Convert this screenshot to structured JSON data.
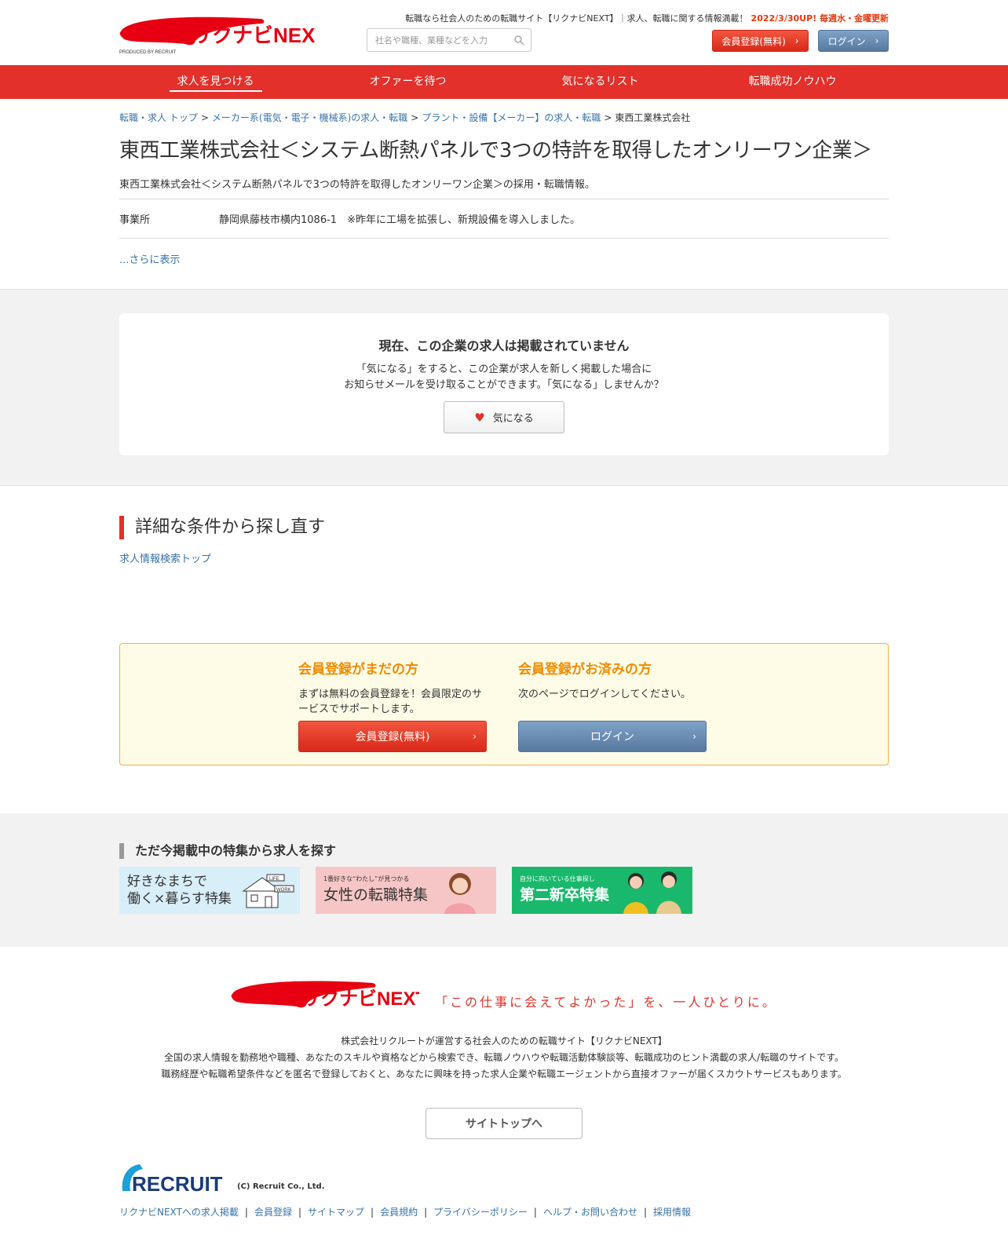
{
  "header": {
    "logo_text": "リクナビNEXT",
    "logo_sub": "PRODUCED BY RECRUIT",
    "tagline": "転職なら社会人のための転職サイト【リクナビNEXT】｜求人、転職に関する情報満載！",
    "update_note": "2022/3/30UP! 毎週水・金曜更新",
    "search_placeholder": "社名や職種、業種などを入力",
    "register_label": "会員登録(無料)",
    "login_label": "ログイン"
  },
  "nav": {
    "items": [
      "求人を見つける",
      "オファーを待つ",
      "気になるリスト",
      "転職成功ノウハウ"
    ]
  },
  "breadcrumb": {
    "items": [
      "転職・求人 トップ",
      "メーカー系(電気・電子・機械系)の求人・転職",
      "プラント・設備【メーカー】の求人・転職"
    ],
    "current": "東西工業株式会社"
  },
  "company": {
    "title": "東西工業株式会社＜システム断熱パネルで3つの特許を取得したオンリーワン企業＞",
    "subtitle": "東西工業株式会社＜システム断熱パネルで3つの特許を取得したオンリーワン企業＞の採用・転職情報。",
    "office_label": "事業所",
    "office_value": "静岡県藤枝市横内1086-1　※昨年に工場を拡張し、新規設備を導入しました。",
    "more_label": "...さらに表示"
  },
  "notice": {
    "heading": "現在、この企業の求人は掲載されていません",
    "line1": "「気になる」をすると、この企業が求人を新しく掲載した場合に",
    "line2": "お知らせメールを受け取ることができます。「気になる」しませんか？",
    "button": "気になる"
  },
  "research": {
    "title": "詳細な条件から探し直す",
    "link": "求人情報検索トップ"
  },
  "member": {
    "new_heading": "会員登録がまだの方",
    "new_text": "まずは無料の会員登録を！会員限定のサービスでサポートします。",
    "new_button": "会員登録(無料)",
    "existing_heading": "会員登録がお済みの方",
    "existing_text": "次のページでログインしてください。",
    "existing_button": "ログイン"
  },
  "features": {
    "title": "ただ今掲載中の特集から求人を探す",
    "banners": [
      {
        "line1": "好きなまちで",
        "line2": "働く×暮らす特集",
        "tag1": "LIFE",
        "tag2": "WORK"
      },
      {
        "small": "1番好きな“わたし”が見つかる",
        "main": "女性の転職特集"
      },
      {
        "small": "自分に向いている仕事探し",
        "main": "第二新卒特集"
      }
    ]
  },
  "footer": {
    "logo_text": "リクナビNEXT",
    "catch": "「この仕事に会えてよかった」を、一人ひとりに。",
    "text1": "株式会社リクルートが運営する社会人のための転職サイト【リクナビNEXT】",
    "text2": "全国の求人情報を勤務地や職種、あなたのスキルや資格などから検索でき、転職ノウハウや転職活動体験談等、転職成功のヒント満載の求人/転職のサイトです。",
    "text3": "職務経歴や転職希望条件などを匿名で登録しておくと、あなたに興味を持った求人企業や転職エージェントから直接オファーが届くスカウトサービスもあります。",
    "top_button": "サイトトップへ",
    "recruit_logo": "RECRUIT",
    "copyright": "(C) Recruit Co., Ltd.",
    "links": [
      "リクナビNEXTへの求人掲載",
      "会員登録",
      "サイトマップ",
      "会員規約",
      "プライバシーポリシー",
      "ヘルプ・お問い合わせ",
      "採用情報"
    ]
  },
  "colors": {
    "brand_red": "#e3302b",
    "link_blue": "#3873a9",
    "orange": "#f08c00",
    "login_blue": "#6a8db4"
  }
}
